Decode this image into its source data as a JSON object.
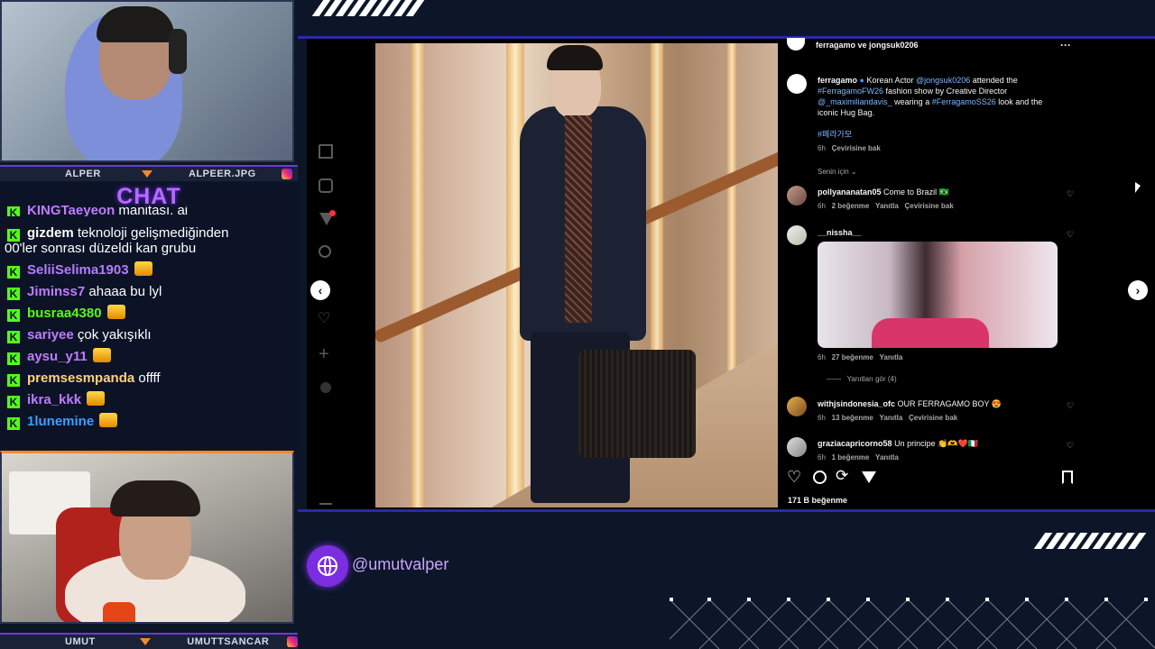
{
  "webcam_top": {
    "left_name": "ALPER",
    "right_name": "ALPEER.JPG"
  },
  "chat": {
    "title": "CHAT",
    "cut_line": {
      "user": "KINGTaeyeon",
      "text": "manitası. ai"
    },
    "messages": [
      {
        "user": "gizdem",
        "color": "#ffffff",
        "text": "teknoloji gelişmediğinden",
        "cont": "00'ler sonrası düzeldi kan grubu"
      },
      {
        "user": "SeliiSelima1903",
        "color": "#b47cff",
        "text": ""
      },
      {
        "user": "Jiminss7",
        "color": "#c07bff",
        "text": "ahaaa bu lyl"
      },
      {
        "user": "busraa4380",
        "color": "#53fc18",
        "text": ""
      },
      {
        "user": "sariyee",
        "color": "#c07bff",
        "text": "çok yakışıklı"
      },
      {
        "user": "aysu_y11",
        "color": "#c07bff",
        "text": ""
      },
      {
        "user": "premsesmpanda",
        "color": "#ffd27a",
        "text": "offff"
      },
      {
        "user": "ikra_kkk",
        "color": "#c07bff",
        "text": ""
      },
      {
        "user": "1lunemine",
        "color": "#3aa0ff",
        "text": ""
      }
    ]
  },
  "webcam_bottom": {
    "left_name": "UMUT",
    "right_name": "UMUTTSANCAR"
  },
  "instagram": {
    "post_header": "ferragamo ve jongsuk0206",
    "caption": {
      "username": "ferragamo",
      "line1_a": "Korean Actor ",
      "line1_mention": "@jongsuk0206",
      "line1_b": " attended the",
      "line2_tag": "#FerragamoFW26",
      "line2_b": " fashion show by Creative Director",
      "line3_mention": "@_maximiliandavis_",
      "line3_b": " wearing a ",
      "line3_tag": "#FerragamoSS26",
      "line3_c": " look and the",
      "line4": "iconic Hug Bag.",
      "hashtag": "#페라가모",
      "time": "6h",
      "translate": "Çevirisine bak"
    },
    "sort_label": "Senin için",
    "comments": [
      {
        "user": "pollyananatan05",
        "text": "Come to Brazil 🇧🇷",
        "time": "6h",
        "likes": "2 beğenme",
        "reply": "Yanıtla",
        "translate": "Çevirisine bak"
      },
      {
        "user": "__nissha__",
        "text": "",
        "time": "6h",
        "likes": "27 beğenme",
        "reply": "Yanıtla",
        "translate": "",
        "view_replies": "Yanıtları gör (4)"
      },
      {
        "user": "withjsindonesia_ofc",
        "text": "OUR FERRAGAMO BOY 😍",
        "time": "6h",
        "likes": "13 beğenme",
        "reply": "Yanıtla",
        "translate": "Çevirisine bak"
      },
      {
        "user": "graziacapricorno58",
        "text": "Un principe 👏🫶❤️🇮🇹",
        "time": "6h",
        "likes": "1 beğenme",
        "reply": "Yanıtla",
        "translate": ""
      }
    ],
    "likes_count": "171 B beğenme"
  },
  "social": {
    "handle": "@umutvalper"
  }
}
